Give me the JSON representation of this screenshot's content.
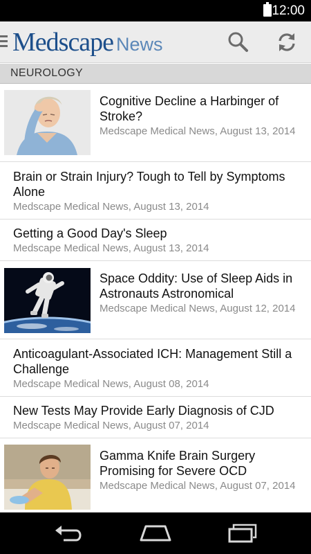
{
  "status_bar": {
    "time": "12:00"
  },
  "app_bar": {
    "brand": "Medscape",
    "section": "News"
  },
  "section_header": "NEUROLOGY",
  "articles": [
    {
      "title": "Cognitive Decline a Harbinger of Stroke?",
      "meta": "Medscape Medical News, August 13, 2014",
      "thumbnail": "woman-headache"
    },
    {
      "title": "Brain or Strain Injury? Tough to Tell by Symptoms Alone",
      "meta": "Medscape Medical News, August 13, 2014"
    },
    {
      "title": "Getting a Good Day's Sleep",
      "meta": "Medscape Medical News, August 13, 2014"
    },
    {
      "title": "Space Oddity: Use of Sleep Aids in Astronauts Astronomical",
      "meta": "Medscape Medical News, August 12, 2014",
      "thumbnail": "astronaut"
    },
    {
      "title": "Anticoagulant-Associated ICH: Management Still a Challenge",
      "meta": "Medscape Medical News, August 08, 2014"
    },
    {
      "title": "New Tests May Provide Early Diagnosis of CJD",
      "meta": "Medscape Medical News, August 07, 2014"
    },
    {
      "title": "Gamma Knife Brain Surgery Promising for Severe OCD",
      "meta": "Medscape Medical News, August 07, 2014",
      "thumbnail": "man-cleaning"
    }
  ]
}
